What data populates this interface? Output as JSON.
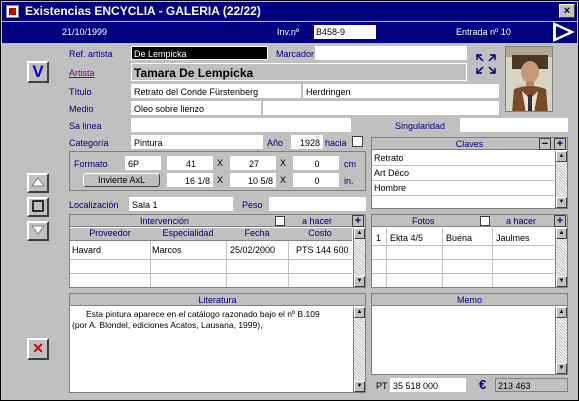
{
  "window": {
    "title": "Existencias ENCYCLIA - GALERIA (22/22)",
    "close_glyph": "×"
  },
  "header": {
    "date": "21/10/1999",
    "inv_label": "Inv.nº",
    "inv_value": "B458-9",
    "entrada": "Entrada nº 10"
  },
  "labels": {
    "ref_artista": "Ref. artista",
    "marcador": "Marcador",
    "artista": "Artista",
    "titulo": "Título",
    "medio": "Medio",
    "sa_linea": "Sa linea",
    "singularidad": "Singularidad",
    "categoria": "Categoría",
    "ano": "Año",
    "hacia": "hacia",
    "formato": "Formato",
    "cm": "cm",
    "in": "in.",
    "localizacion": "Localización",
    "peso": "Peso"
  },
  "fields": {
    "ref_artista": "De Lempicka",
    "marcador": "",
    "artista": "Tamara De Lempicka",
    "titulo_1": "Retrato del Conde Fürstenberg",
    "titulo_2": "Herdringen",
    "medio": "Oleo sobre lienzo",
    "sa_linea": "",
    "singularidad": "",
    "categoria": "Pintura",
    "ano": "1928",
    "formato_code": "6P",
    "cm_w": "41",
    "cm_h": "27",
    "cm_d": "0",
    "in_w": "16",
    "in_w_frac": "1/8",
    "in_h": "10",
    "in_h_frac": "5/8",
    "in_d": "0",
    "localizacion": "Sala 1",
    "peso": ""
  },
  "buttons": {
    "invierte": "Invierte AxL",
    "v_glyph": "V",
    "x_glyph": "✕",
    "plus": "+",
    "minus": "−"
  },
  "claves": {
    "title": "Claves",
    "items": [
      "Retrato",
      "Art Déco",
      "Hombre"
    ]
  },
  "intervencion": {
    "title": "Intervención",
    "a_hacer": "a hacer",
    "columns": [
      "Proveedor",
      "Especialidad",
      "Fecha",
      "Costo"
    ],
    "rows": [
      [
        "Havard",
        "Marcos",
        "25/02/2000",
        "PTS 144 600"
      ]
    ]
  },
  "fotos": {
    "title": "Fotos",
    "a_hacer": "a hacer",
    "rows": [
      [
        "1",
        "Ekta 4/5",
        "Buena",
        "Jaulmes"
      ]
    ]
  },
  "literatura": {
    "title": "Literatura",
    "line1": "Esta pintura aparece en el catálogo razonado bajo el nº B.109",
    "line2": "(por A. Blondel, ediciones Acatos, Lausana, 1999),"
  },
  "memo": {
    "title": "Memo"
  },
  "prices": {
    "pt_label": "PT",
    "pt_value": "35 518 000",
    "euro_symbol": "€",
    "euro_value": "213 463"
  },
  "colors": {
    "accent": "#000080",
    "delete": "#cc0000"
  }
}
